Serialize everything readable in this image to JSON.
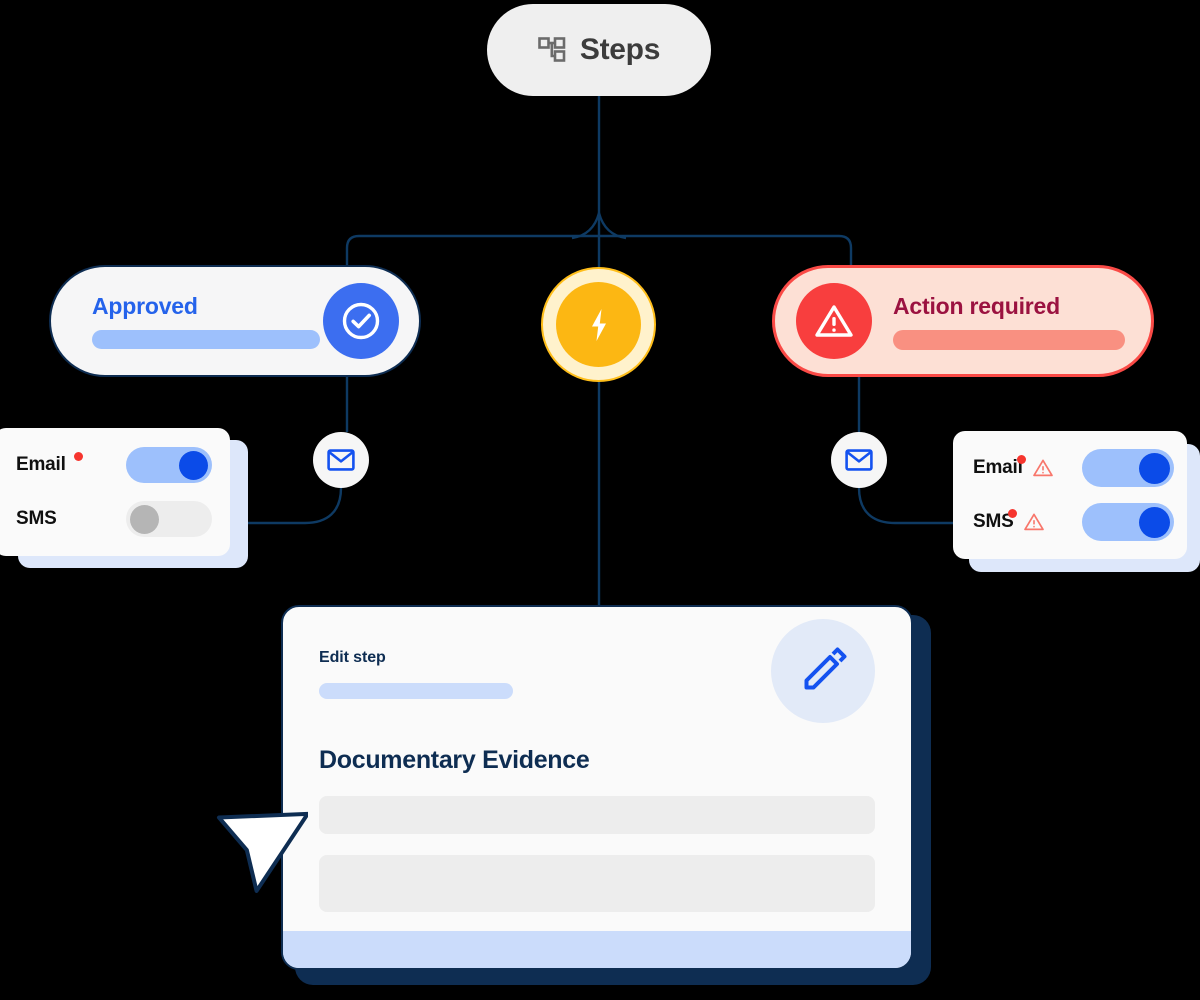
{
  "header": {
    "pill_label": "Steps",
    "pill_icon": "hierarchy-icon"
  },
  "branches": {
    "approved": {
      "title": "Approved",
      "status_icon": "check-circle-icon",
      "accent_color": "#2563EB",
      "badge_color": "#3C6EF0",
      "bar_color": "#9DC0FC",
      "card_bg": "#F6F6F7",
      "border_color": "#0E2D52"
    },
    "action_required": {
      "title": "Action required",
      "status_icon": "warning-triangle-icon",
      "accent_color": "#9B1240",
      "badge_color": "#F83E3E",
      "bar_color": "#F99081",
      "card_bg": "#FDE0D5",
      "border_color": "#FA4A46"
    },
    "trigger": {
      "icon": "lightning-bolt-icon",
      "ring_color": "#FFF2CC",
      "core_color": "#FCB713",
      "border_color": "#FFBE1A"
    }
  },
  "channels": {
    "left_connector_icon": "envelope-icon",
    "right_connector_icon": "envelope-icon",
    "left_panel": {
      "rows": [
        {
          "label": "Email",
          "has_dot": true,
          "has_warning": false,
          "toggle": "on"
        },
        {
          "label": "SMS",
          "has_dot": false,
          "has_warning": false,
          "toggle": "off"
        }
      ]
    },
    "right_panel": {
      "rows": [
        {
          "label": "Email",
          "has_dot": true,
          "has_warning": true,
          "toggle": "on"
        },
        {
          "label": "SMS",
          "has_dot": true,
          "has_warning": true,
          "toggle": "on"
        }
      ]
    },
    "toggle_colors": {
      "on_track": "#9DC0FC",
      "on_knob": "#0B4BE8",
      "off_track": "#EDEDED",
      "off_knob": "#B5B5B5"
    },
    "dot_color": "#F6352E",
    "warning_color": "#F8766B"
  },
  "edit_card": {
    "eyebrow": "Edit step",
    "heading": "Documentary Evidence",
    "edit_icon": "pencil-icon",
    "placeholder_rows": 2,
    "subbar_color": "#CBDCFB",
    "footer_color": "#CBDCFB",
    "shadow_color": "#0E2D52"
  },
  "pointer": {
    "icon": "cursor-arrow-icon"
  },
  "canvas": {
    "background": "#000000",
    "wire_color": "#0E3A63"
  }
}
